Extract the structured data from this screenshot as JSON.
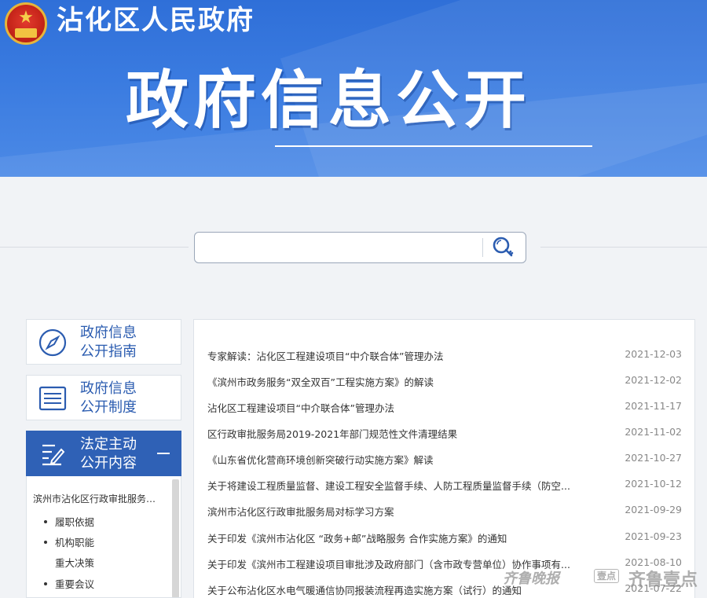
{
  "header": {
    "gov_name": "沾化区人民政府",
    "banner_title": "政府信息公开",
    "accent": "#2f6fd8"
  },
  "search": {
    "placeholder": "",
    "icon": "search-key-icon"
  },
  "sidebar": {
    "cards": [
      {
        "label_line1": "政府信息",
        "label_line2": "公开指南",
        "icon": "compass-icon"
      },
      {
        "label_line1": "政府信息",
        "label_line2": "公开制度",
        "icon": "document-list-icon"
      },
      {
        "label_line1": "法定主动",
        "label_line2": "公开内容",
        "icon": "edit-icon",
        "active": true
      }
    ],
    "subpanel": {
      "head": "滨州市沾化区行政审批服务…",
      "items": [
        "履职依据",
        "机构职能",
        "重大决策",
        "重要会议"
      ]
    }
  },
  "news": [
    {
      "title": "专家解读：沾化区工程建设项目“中介联合体”管理办法",
      "date": "2021-12-03"
    },
    {
      "title": "《滨州市政务服务“双全双百”工程实施方案》的解读",
      "date": "2021-12-02"
    },
    {
      "title": "沾化区工程建设项目“中介联合体”管理办法",
      "date": "2021-11-17"
    },
    {
      "title": "区行政审批服务局2019-2021年部门规范性文件清理结果",
      "date": "2021-11-02"
    },
    {
      "title": "《山东省优化营商环境创新突破行动实施方案》解读",
      "date": "2021-10-27"
    },
    {
      "title": "关于将建设工程质量监督、建设工程安全监督手续、人防工程质量监督手续（防空...",
      "date": "2021-10-12"
    },
    {
      "title": "滨州市沾化区行政审批服务局对标学习方案",
      "date": "2021-09-29"
    },
    {
      "title": "关于印发《滨州市沾化区 “政务+邮”战略服务 合作实施方案》的通知",
      "date": "2021-09-23"
    },
    {
      "title": "关于印发《滨州市工程建设项目审批涉及政府部门（含市政专营单位）协作事项有...",
      "date": "2021-08-10"
    },
    {
      "title": "关于公布沾化区水电气暖通信协同报装流程再造实施方案（试行）的通知",
      "date": "2021-07-22"
    }
  ],
  "watermark": {
    "left": "齐鲁晚报",
    "badge": "壹点",
    "right": "齐鲁壹点"
  }
}
